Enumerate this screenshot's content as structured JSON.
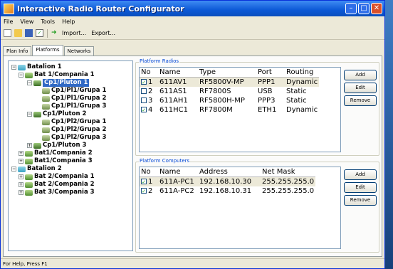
{
  "window": {
    "title": "Interactive Radio Router Configurator"
  },
  "menu": [
    "File",
    "View",
    "Tools",
    "Help"
  ],
  "toolbar": {
    "import_label": "Import...",
    "export_label": "Export..."
  },
  "tabs": [
    "Plan Info",
    "Platforms",
    "Networks"
  ],
  "tree": [
    "Batalion 1",
    "Bat 1/Compania 1",
    "Cp1/Pluton 1",
    "Cp1/Pl1/Grupa 1",
    "Cp1/Pl1/Grupa 2",
    "Cp1/Pl1/Grupa 3",
    "Cp1/Pluton 2",
    "Cp1/Pl2/Grupa 1",
    "Cp1/Pl2/Grupa 2",
    "Cp1/Pl2/Grupa 3",
    "Cp1/Pluton 3",
    "Bat1/Compania 2",
    "Bat1/Compania 3",
    "Batalion 2",
    "Bat 2/Compania 1",
    "Bat 2/Compania 2",
    "Bat 3/Compania 3"
  ],
  "radios": {
    "title": "Platform Radios",
    "headers": [
      "No",
      "Name",
      "Type",
      "Port",
      "Routing"
    ],
    "rows": [
      [
        "1",
        "611AV1",
        "RF5800V-MP",
        "PPP1",
        "Dynamic"
      ],
      [
        "2",
        "611AS1",
        "RF7800S",
        "USB",
        "Static"
      ],
      [
        "3",
        "611AH1",
        "RF5800H-MP",
        "PPP3",
        "Static"
      ],
      [
        "4",
        "611HC1",
        "RF7800M",
        "ETH1",
        "Dynamic"
      ]
    ],
    "checked": [
      true,
      false,
      false,
      true
    ],
    "buttons": [
      "Add",
      "Edit",
      "Remove"
    ]
  },
  "computers": {
    "title": "Platform Computers",
    "headers": [
      "No",
      "Name",
      "Address",
      "Net Mask"
    ],
    "rows": [
      [
        "1",
        "611A-PC1",
        "192.168.10.30",
        "255.255.255.0"
      ],
      [
        "2",
        "611A-PC2",
        "192.168.10.31",
        "255.255.255.0"
      ]
    ],
    "checked": [
      true,
      true
    ],
    "buttons": [
      "Add",
      "Edit",
      "Remove"
    ]
  },
  "status": "For Help, Press F1"
}
